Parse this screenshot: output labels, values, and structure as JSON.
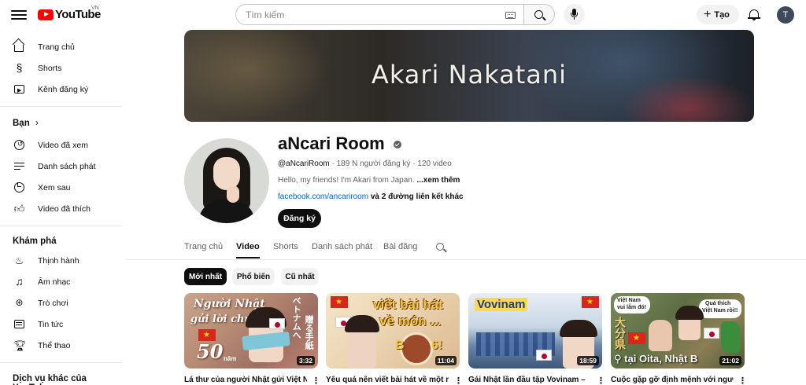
{
  "header": {
    "logo_text": "YouTube",
    "country_code": "VN",
    "search_placeholder": "Tìm kiếm",
    "create_label": "Tạo",
    "avatar_letter": "T"
  },
  "sidebar": {
    "main": [
      {
        "label": "Trang chủ",
        "icon": "home-icon"
      },
      {
        "label": "Shorts",
        "icon": "shorts-icon"
      },
      {
        "label": "Kênh đăng ký",
        "icon": "subscriptions-icon"
      }
    ],
    "you_heading": "Bạn",
    "you": [
      {
        "label": "Video đã xem",
        "icon": "history-icon"
      },
      {
        "label": "Danh sách phát",
        "icon": "playlists-icon"
      },
      {
        "label": "Xem sau",
        "icon": "watch-later-icon"
      },
      {
        "label": "Video đã thích",
        "icon": "like-icon"
      }
    ],
    "explore_heading": "Khám phá",
    "explore": [
      {
        "label": "Thịnh hành",
        "icon": "trending-icon"
      },
      {
        "label": "Âm nhạc",
        "icon": "music-icon"
      },
      {
        "label": "Trò chơi",
        "icon": "gaming-icon"
      },
      {
        "label": "Tin tức",
        "icon": "news-icon"
      },
      {
        "label": "Thể thao",
        "icon": "sports-icon"
      }
    ],
    "more_heading": "Dịch vụ khác của YouTube"
  },
  "banner": {
    "title": "Akari Nakatani"
  },
  "channel": {
    "name": "aNcari Room",
    "handle": "@aNcariRoom",
    "subscribers": "189 N người đăng ký",
    "videos": "120 video",
    "description": "Hello, my friends! I'm Akari from Japan.",
    "more_label": "...xem thêm",
    "link": "facebook.com/ancariroom",
    "extra_links": "và 2 đường liên kết khác",
    "subscribe_label": "Đăng ký"
  },
  "tabs": [
    "Trang chủ",
    "Video",
    "Shorts",
    "Danh sách phát",
    "Bài đăng"
  ],
  "active_tab": "Video",
  "chips": [
    "Mới nhất",
    "Phổ biến",
    "Cũ nhất"
  ],
  "active_chip": "Mới nhất",
  "videos": [
    {
      "title": "Lá thư của người Nhật gửi Việt Nam",
      "duration": "3:32",
      "overlay": [
        "Người Nhật",
        "gửi lời chúc",
        "50",
        "năm",
        "ベトナムへ",
        "贈る手紙"
      ]
    },
    {
      "title": "Yêu quá nên viết bài hát về một món",
      "duration": "11:04",
      "overlay": [
        "viết bài hát",
        "về món ...",
        "B",
        "6!"
      ]
    },
    {
      "title": "Gái Nhật lần đầu tập Vovinam –",
      "duration": "18:59",
      "overlay": [
        "Vovinam"
      ]
    },
    {
      "title": "Cuộc gặp gỡ định mệnh với người",
      "duration": "21:02",
      "overlay": [
        "Việt Nam",
        "vui lắm đó!",
        "Quá thích",
        "Việt Nam rồi!!",
        "大分県",
        "tại Oita, Nhật B"
      ]
    }
  ],
  "colors": {
    "brand_red": "#ff0000",
    "link_blue": "#065fd4",
    "text_secondary": "#606060"
  }
}
